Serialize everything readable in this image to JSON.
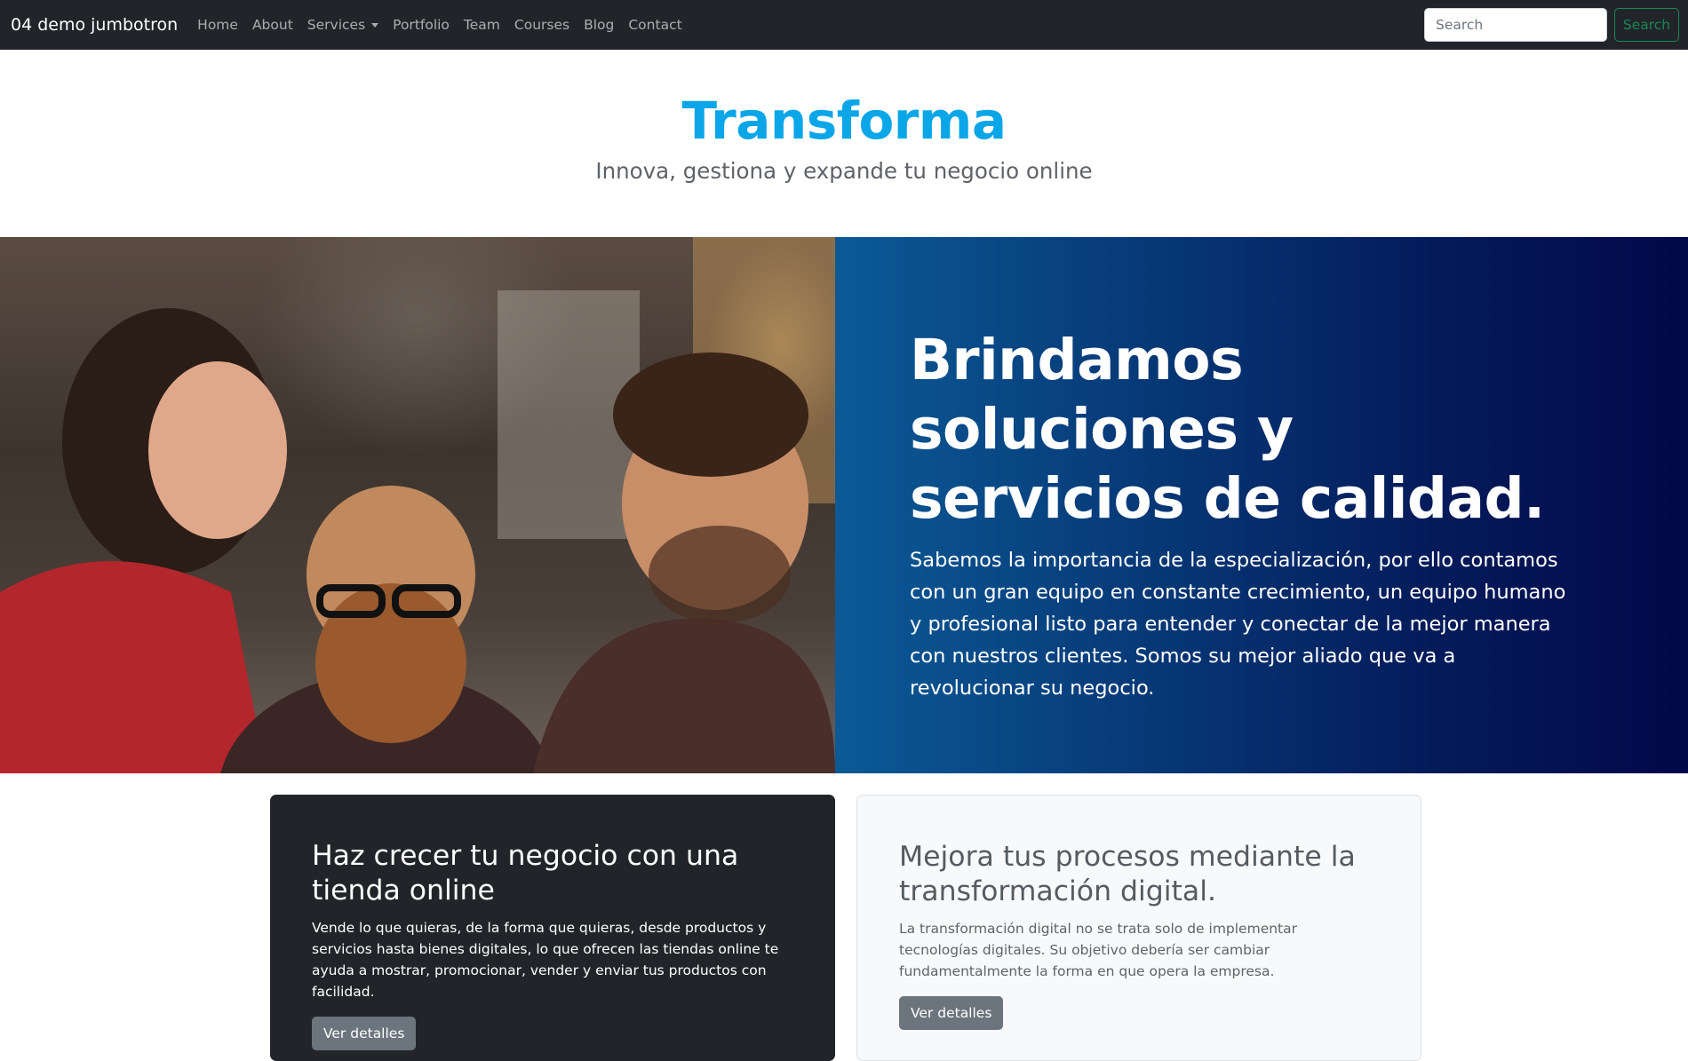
{
  "navbar": {
    "brand": "04 demo jumbotron",
    "links": [
      "Home",
      "About",
      "Services",
      "Portfolio",
      "Team",
      "Courses",
      "Blog",
      "Contact"
    ],
    "search_placeholder": "Search",
    "search_button": "Search"
  },
  "header": {
    "title": "Transforma",
    "subtitle": "Innova, gestiona y expande tu negocio online"
  },
  "banner": {
    "heading": "Brindamos soluciones y servicios de calidad.",
    "text": "Sabemos la importancia de la especialización, por ello contamos con un gran equipo en constante crecimiento, un equipo humano y profesional listo para entender y conectar de la mejor manera con nuestros clientes. Somos su mejor aliado que va a revolucionar su negocio."
  },
  "cards": [
    {
      "title": "Haz crecer tu negocio con una tienda online",
      "text": "Vende lo que quieras, de la forma que quieras, desde productos y servicios hasta bienes digitales, lo que ofrecen las tiendas online te ayuda a mostrar, promocionar, vender y enviar tus productos con facilidad.",
      "button": "Ver detalles"
    },
    {
      "title": "Mejora tus procesos mediante la transformación digital.",
      "text": "La transformación digital no se trata solo de implementar tecnologías digitales. Su objetivo debería ser cambiar fundamentalmente la forma en que opera la empresa.",
      "button": "Ver detalles"
    }
  ],
  "colors": {
    "navbar_bg": "#212529",
    "title_blue": "#0aa6e8",
    "success_green": "#198754",
    "banner_gradient_start": "#0b5a96",
    "banner_gradient_end": "#02084a",
    "button_gray": "#6c757d"
  }
}
